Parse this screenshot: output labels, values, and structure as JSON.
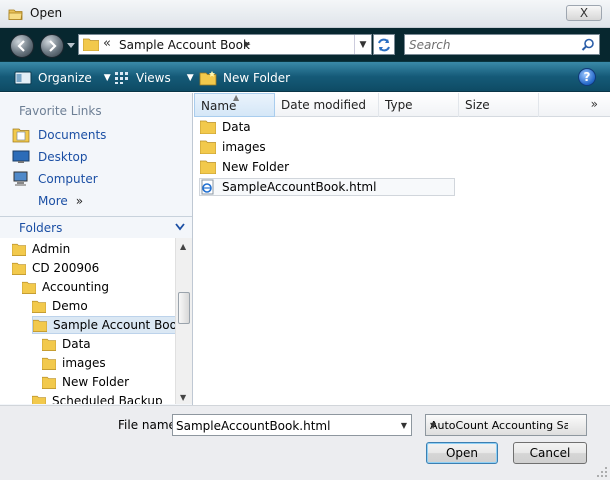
{
  "window": {
    "title": "Open",
    "close_label": "X"
  },
  "address": {
    "path_prefix": "«",
    "path_label": "Sample Account Book",
    "path_suffix": "▸",
    "search_placeholder": "Search"
  },
  "commandbar": {
    "organize_label": "Organize",
    "views_label": "Views",
    "new_folder_label": "New Folder",
    "help_label": "?"
  },
  "favorites": {
    "title": "Favorite Links",
    "items": [
      {
        "label": "Documents",
        "icon": "documents-icon"
      },
      {
        "label": "Desktop",
        "icon": "desktop-icon"
      },
      {
        "label": "Computer",
        "icon": "computer-icon"
      },
      {
        "label": "More",
        "icon": "more-icon",
        "suffix": "»"
      }
    ]
  },
  "folders": {
    "header": "Folders",
    "tree": [
      {
        "label": "Admin",
        "level": 0
      },
      {
        "label": "CD 200906",
        "level": 0
      },
      {
        "label": "Accounting",
        "level": 1
      },
      {
        "label": "Demo",
        "level": 2
      },
      {
        "label": "Sample Account Book",
        "level": 2,
        "selected": true
      },
      {
        "label": "Data",
        "level": 3
      },
      {
        "label": "images",
        "level": 3
      },
      {
        "label": "New Folder",
        "level": 3
      },
      {
        "label": "Scheduled Backup",
        "level": 2
      }
    ]
  },
  "columns": {
    "name": "Name",
    "date": "Date modified",
    "type": "Type",
    "size": "Size",
    "more": "»"
  },
  "files": [
    {
      "name": "Data",
      "kind": "folder"
    },
    {
      "name": "images",
      "kind": "folder"
    },
    {
      "name": "New Folder",
      "kind": "folder"
    },
    {
      "name": "SampleAccountBook.html",
      "kind": "html"
    }
  ],
  "bottom": {
    "file_name_label": "File name:",
    "file_name_value": "SampleAccountBook.html",
    "file_type_value": "AutoCount Accounting Sampl",
    "open_label": "Open",
    "cancel_label": "Cancel"
  },
  "colors": {
    "address_bg": "#07272f",
    "command_bg": "#155a78",
    "link_blue": "#1b4fa4",
    "folder_yellow": "#f2c94c"
  }
}
